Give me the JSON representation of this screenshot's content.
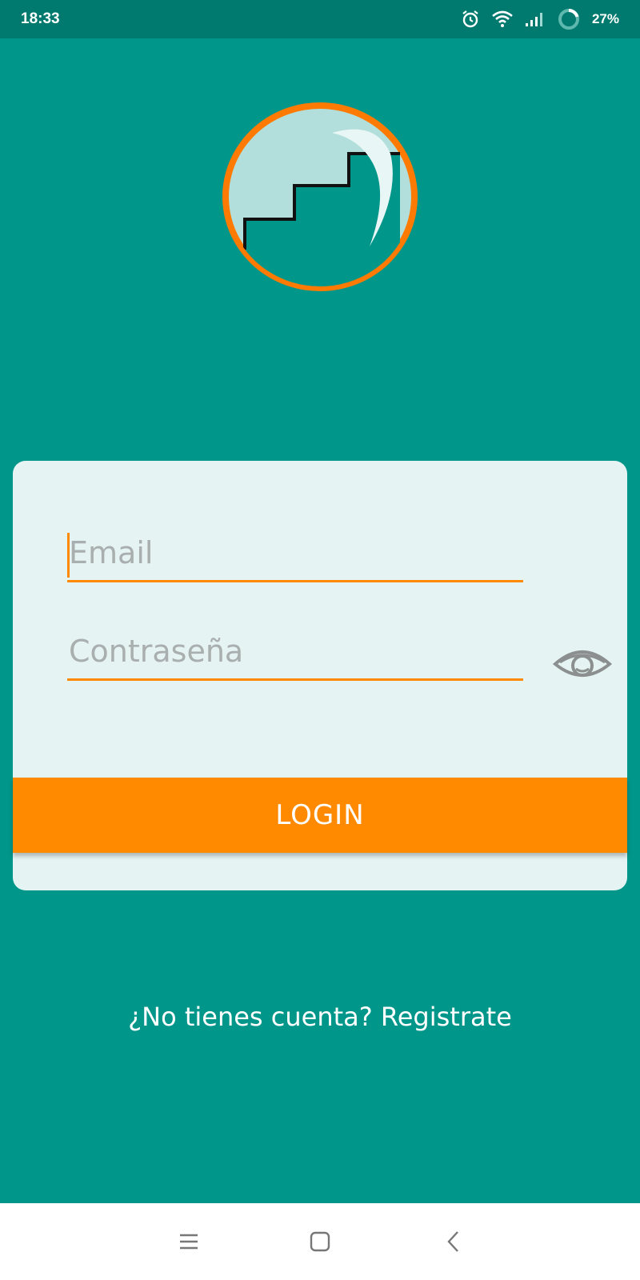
{
  "status_bar": {
    "time": "18:33",
    "battery": "27%",
    "icons": [
      "alarm-icon",
      "wifi-icon",
      "signal-icon",
      "battery-ring-icon"
    ]
  },
  "logo": {
    "icon": "stairs-moon-logo",
    "colors": {
      "ring": "#ff7a00",
      "disc": "#b2dfdb",
      "inner": "#00968a",
      "moon": "#e8f6f5"
    }
  },
  "login_form": {
    "email_placeholder": "Email",
    "password_placeholder": "Contraseña",
    "email_value": "",
    "password_value": "",
    "toggle_visibility_icon": "eye-icon",
    "login_label": "LOGIN"
  },
  "register_text": "¿No tienes cuenta? Registrate",
  "nav_bar": {
    "icons": [
      "menu-icon",
      "home-icon",
      "back-icon"
    ]
  },
  "colors": {
    "background": "#00968a",
    "status_bar": "#00796f",
    "card": "#e5f3f2",
    "accent": "#ff8a00"
  }
}
